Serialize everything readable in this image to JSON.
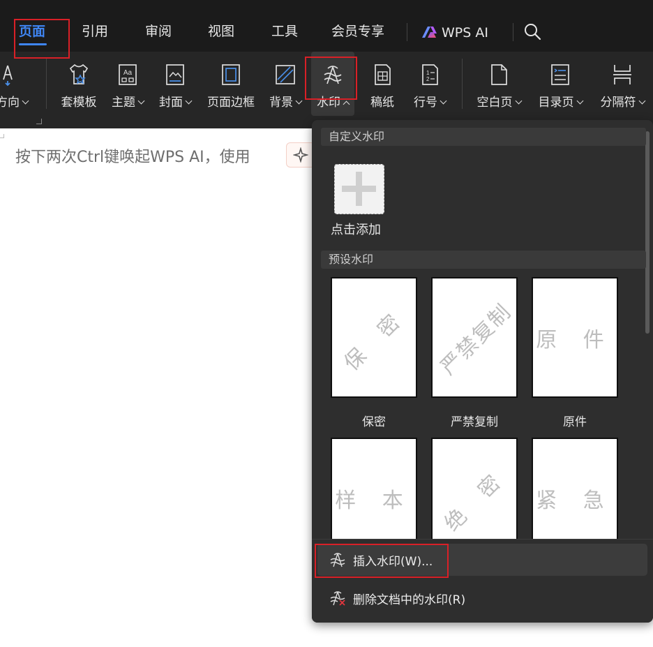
{
  "menu_tabs": [
    {
      "label": "页面",
      "active": true
    },
    {
      "label": "引用"
    },
    {
      "label": "审阅"
    },
    {
      "label": "视图"
    },
    {
      "label": "工具"
    },
    {
      "label": "会员专享"
    },
    {
      "label": "WPS AI"
    }
  ],
  "ribbon": {
    "direction_label": "方向",
    "template_label": "套模板",
    "theme_label": "主题",
    "cover_label": "封面",
    "border_label": "页面边框",
    "background_label": "背景",
    "watermark_label": "水印",
    "draft_paper_label": "稿纸",
    "line_number_label": "行号",
    "blank_page_label": "空白页",
    "toc_page_label": "目录页",
    "separator_label": "分隔符"
  },
  "document": {
    "hint": "按下两次Ctrl键唤起WPS AI，使用"
  },
  "watermark_panel": {
    "custom_header": "自定义水印",
    "add_label": "点击添加",
    "preset_header": "预设水印",
    "presets": [
      {
        "label": "保密",
        "text": "保 密"
      },
      {
        "label": "严禁复制",
        "text": "严禁复制"
      },
      {
        "label": "原件",
        "text": "原 件"
      },
      {
        "label": "样本",
        "text": "样 本"
      },
      {
        "label": "绝密",
        "text": "绝 密"
      },
      {
        "label": "紧急",
        "text": "紧 急"
      }
    ],
    "insert_label": "插入水印(W)...",
    "delete_label": "删除文档中的水印(R)"
  },
  "colors": {
    "accent_blue": "#3f86f5",
    "highlight_red": "#d92027",
    "ai_logo_gradient": [
      "#7b5cff",
      "#ff4f70"
    ]
  },
  "icons": [
    "search-icon",
    "watermark-icon",
    "delete-watermark-icon",
    "wps-ai-logo-icon"
  ]
}
